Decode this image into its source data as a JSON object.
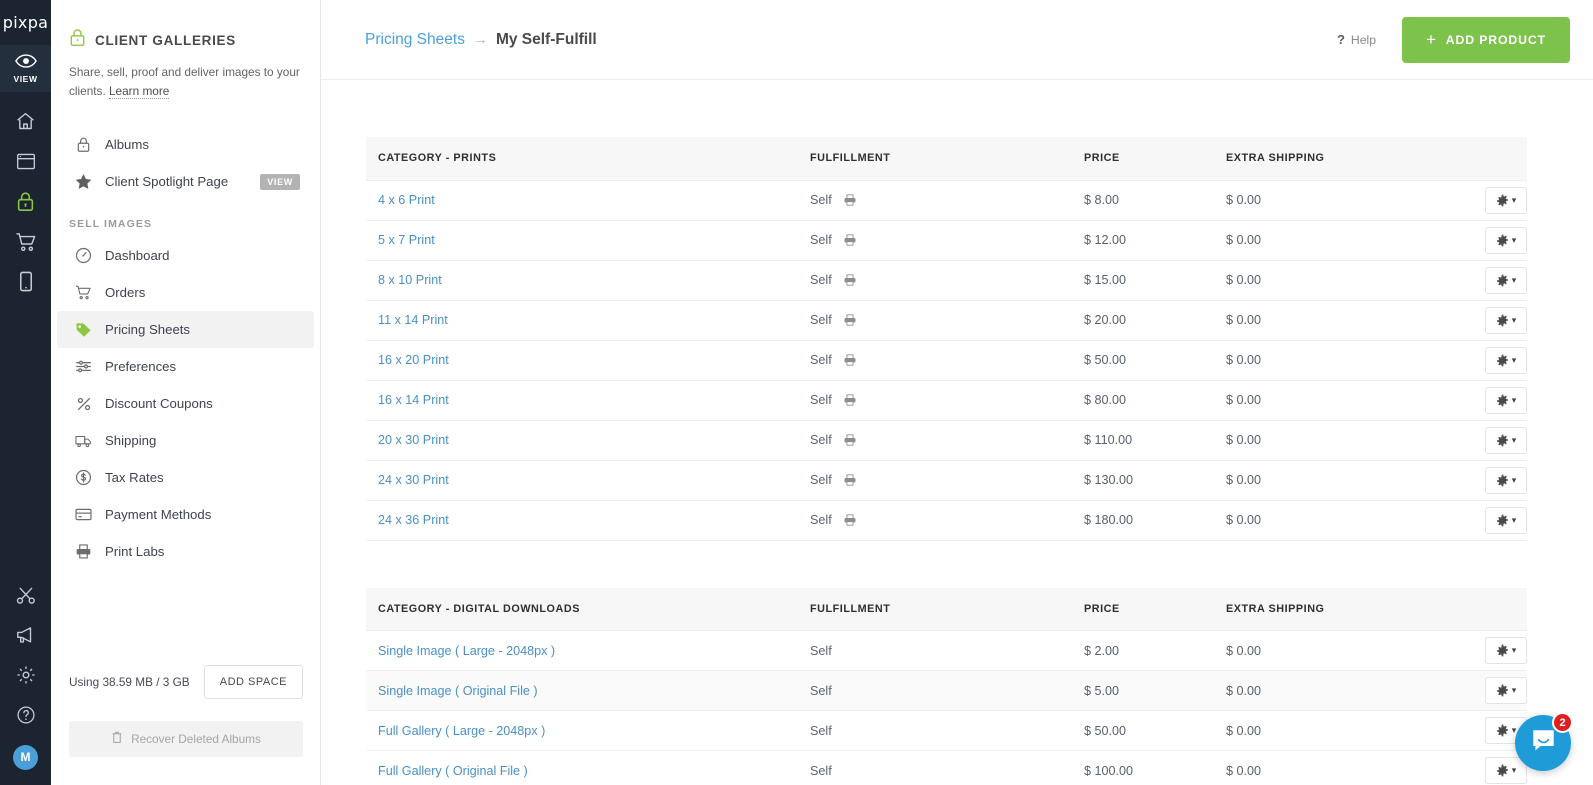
{
  "brand": {
    "logo_text": "pixpa",
    "accent_green": "#7dc24b",
    "link_blue": "#4a9fd8",
    "rail_bg": "#1b2430"
  },
  "rail": {
    "view_label": "VIEW",
    "items": [
      {
        "name": "eye-icon",
        "label": "VIEW"
      },
      {
        "name": "home-icon",
        "label": "Home"
      },
      {
        "name": "window-icon",
        "label": "Website"
      },
      {
        "name": "lock-icon",
        "label": "Client Galleries"
      },
      {
        "name": "cart-icon",
        "label": "Store"
      },
      {
        "name": "mobile-icon",
        "label": "Mobile"
      },
      {
        "name": "scissors-icon",
        "label": "Tools"
      },
      {
        "name": "megaphone-icon",
        "label": "Marketing"
      },
      {
        "name": "gear-icon",
        "label": "Settings"
      },
      {
        "name": "help-circle-icon",
        "label": "Help"
      }
    ],
    "avatar_initial": "M"
  },
  "sidebar": {
    "title": "CLIENT GALLERIES",
    "description": "Share, sell, proof and deliver images to your clients.",
    "learn_more": "Learn more",
    "top_items": [
      {
        "label": "Albums",
        "icon": "lock-icon",
        "badge": null
      },
      {
        "label": "Client Spotlight Page",
        "icon": "star-icon",
        "badge": "VIEW"
      }
    ],
    "section_label": "SELL IMAGES",
    "items": [
      {
        "label": "Dashboard",
        "icon": "gauge-icon",
        "active": false
      },
      {
        "label": "Orders",
        "icon": "cart-icon",
        "active": false
      },
      {
        "label": "Pricing Sheets",
        "icon": "tag-icon",
        "active": true
      },
      {
        "label": "Preferences",
        "icon": "sliders-icon",
        "active": false
      },
      {
        "label": "Discount Coupons",
        "icon": "percent-icon",
        "active": false
      },
      {
        "label": "Shipping",
        "icon": "truck-icon",
        "active": false
      },
      {
        "label": "Tax Rates",
        "icon": "dollar-circle-icon",
        "active": false
      },
      {
        "label": "Payment Methods",
        "icon": "credit-card-icon",
        "active": false
      },
      {
        "label": "Print Labs",
        "icon": "printer-icon",
        "active": false
      }
    ],
    "storage_text": "Using 38.59 MB / 3 GB",
    "add_space_label": "ADD SPACE",
    "recover_label": "Recover Deleted Albums"
  },
  "header": {
    "breadcrumb_parent": "Pricing Sheets",
    "breadcrumb_separator": "→",
    "breadcrumb_current": "My Self-Fulfill",
    "help_label": "Help",
    "help_mark": "?",
    "add_product_label": "ADD PRODUCT",
    "add_product_plus": "+"
  },
  "tables": [
    {
      "columns": [
        "CATEGORY - PRINTS",
        "FULFILLMENT",
        "PRICE",
        "EXTRA SHIPPING",
        ""
      ],
      "show_printer_icon": true,
      "rows": [
        {
          "name": "4 x 6 Print",
          "fulfillment": "Self",
          "price": "$ 8.00",
          "extra_shipping": "$ 0.00"
        },
        {
          "name": "5 x 7 Print",
          "fulfillment": "Self",
          "price": "$ 12.00",
          "extra_shipping": "$ 0.00"
        },
        {
          "name": "8 x 10 Print",
          "fulfillment": "Self",
          "price": "$ 15.00",
          "extra_shipping": "$ 0.00"
        },
        {
          "name": "11 x 14 Print",
          "fulfillment": "Self",
          "price": "$ 20.00",
          "extra_shipping": "$ 0.00"
        },
        {
          "name": "16 x 20 Print",
          "fulfillment": "Self",
          "price": "$ 50.00",
          "extra_shipping": "$ 0.00"
        },
        {
          "name": "16 x 14 Print",
          "fulfillment": "Self",
          "price": "$ 80.00",
          "extra_shipping": "$ 0.00"
        },
        {
          "name": "20 x 30 Print",
          "fulfillment": "Self",
          "price": "$ 110.00",
          "extra_shipping": "$ 0.00"
        },
        {
          "name": "24 x 30 Print",
          "fulfillment": "Self",
          "price": "$ 130.00",
          "extra_shipping": "$ 0.00"
        },
        {
          "name": "24 x 36 Print",
          "fulfillment": "Self",
          "price": "$ 180.00",
          "extra_shipping": "$ 0.00"
        }
      ]
    },
    {
      "columns": [
        "CATEGORY - DIGITAL DOWNLOADS",
        "FULFILLMENT",
        "PRICE",
        "EXTRA SHIPPING",
        ""
      ],
      "show_printer_icon": false,
      "rows": [
        {
          "name": "Single Image ( Large - 2048px )",
          "fulfillment": "Self",
          "price": "$ 2.00",
          "extra_shipping": "$ 0.00"
        },
        {
          "name": "Single Image ( Original File )",
          "fulfillment": "Self",
          "price": "$ 5.00",
          "extra_shipping": "$ 0.00",
          "alt": true
        },
        {
          "name": "Full Gallery ( Large - 2048px )",
          "fulfillment": "Self",
          "price": "$ 50.00",
          "extra_shipping": "$ 0.00"
        },
        {
          "name": "Full Gallery ( Original File )",
          "fulfillment": "Self",
          "price": "$ 100.00",
          "extra_shipping": "$ 0.00"
        }
      ]
    }
  ],
  "intercom": {
    "badge_count": "2"
  }
}
